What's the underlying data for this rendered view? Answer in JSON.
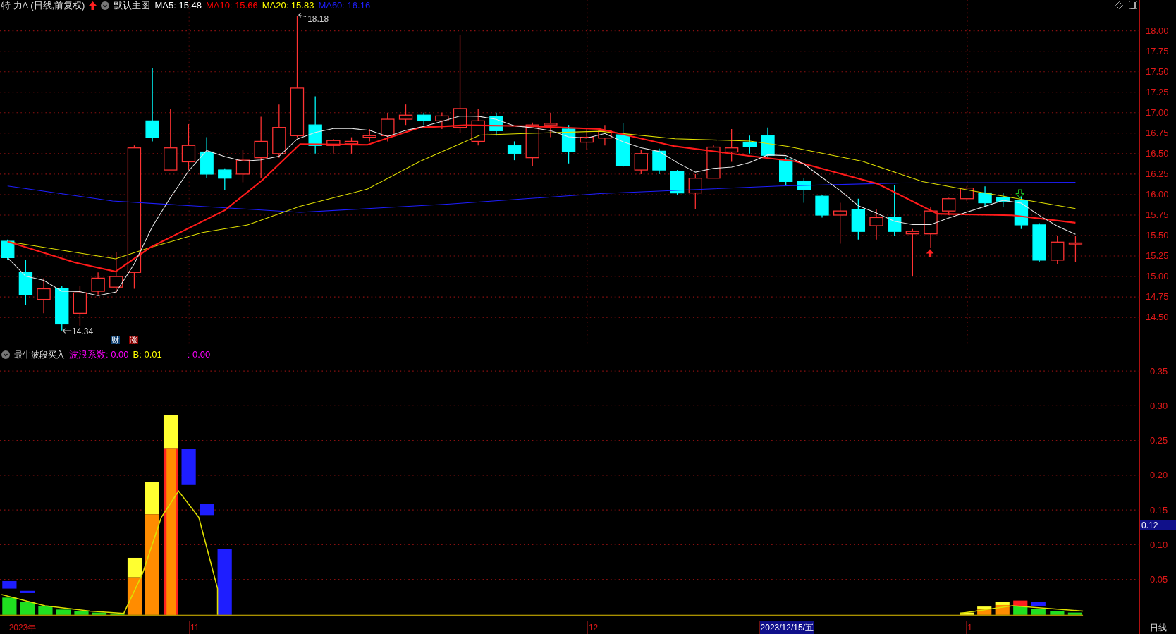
{
  "header": {
    "symbol": "特 力A (日线,前复权)",
    "template": "默认主图",
    "indicators": [
      {
        "label": "MA5: 15.48",
        "color": "#ffffff"
      },
      {
        "label": "MA10: 15.66",
        "color": "#ff0000"
      },
      {
        "label": "MA20: 15.83",
        "color": "#ffff00"
      },
      {
        "label": "MA60: 16.16",
        "color": "#1e1eff"
      }
    ]
  },
  "price_chart": {
    "high_label": "18.18",
    "low_label": "14.34",
    "badges": [
      {
        "text": "财",
        "color": "#0b3d6e"
      },
      {
        "text": "涨",
        "color": "#8b0000"
      }
    ],
    "y_ticks": [
      "18.00",
      "17.75",
      "17.50",
      "17.25",
      "17.00",
      "16.75",
      "16.50",
      "16.25",
      "16.00",
      "15.75",
      "15.50",
      "15.25",
      "15.00",
      "14.75",
      "14.50"
    ]
  },
  "indicator_panel": {
    "title": "最牛波段买入",
    "values": [
      {
        "label": "波浪系数: 0.00",
        "color": "#ff00ff"
      },
      {
        "label": "B: 0.01",
        "color": "#ffff00"
      },
      {
        "label": ": 0.00",
        "color": "#ff00ff"
      }
    ],
    "y_ticks": [
      "0.35",
      "0.30",
      "0.25",
      "0.20",
      "0.15",
      "0.10",
      "0.05"
    ],
    "current_value": "0.12"
  },
  "time_axis": {
    "labels": [
      {
        "text": "2023年",
        "selected": false
      },
      {
        "text": "11",
        "selected": false
      },
      {
        "text": "12",
        "selected": false
      },
      {
        "text": "2023/12/15/五",
        "selected": true
      },
      {
        "text": "1",
        "selected": false
      }
    ],
    "period": "日线"
  }
}
